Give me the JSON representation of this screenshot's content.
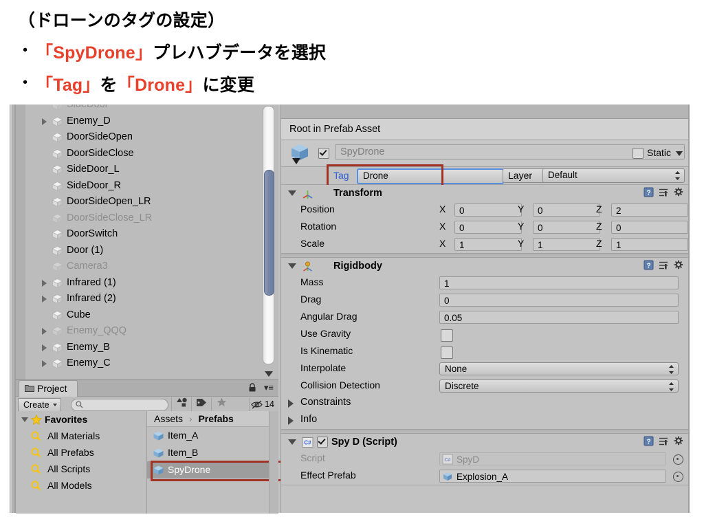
{
  "slide": {
    "line1": "（ドローンのタグの設定）",
    "bullet": "・",
    "line2_a": "「SpyDrone」",
    "line2_b": "プレハブデータを選択",
    "line3_a": "「Tag」",
    "line3_b": "を",
    "line3_c": "「Drone」",
    "line3_d": "に変更",
    "accent_color": "#e8402a"
  },
  "hierarchy": {
    "rows": [
      {
        "label": "SideDoor",
        "expandable": false,
        "dim": true,
        "clipped": true
      },
      {
        "label": "Enemy_D",
        "expandable": true,
        "dim": false
      },
      {
        "label": "DoorSideOpen",
        "expandable": false,
        "dim": false
      },
      {
        "label": "DoorSideClose",
        "expandable": false,
        "dim": false
      },
      {
        "label": "SideDoor_L",
        "expandable": false,
        "dim": false
      },
      {
        "label": "SideDoor_R",
        "expandable": false,
        "dim": false
      },
      {
        "label": "DoorSideOpen_LR",
        "expandable": false,
        "dim": false
      },
      {
        "label": "DoorSideClose_LR",
        "expandable": false,
        "dim": true
      },
      {
        "label": "DoorSwitch",
        "expandable": false,
        "dim": false
      },
      {
        "label": "Door (1)",
        "expandable": false,
        "dim": false
      },
      {
        "label": "Camera3",
        "expandable": false,
        "dim": true
      },
      {
        "label": "Infrared (1)",
        "expandable": true,
        "dim": false
      },
      {
        "label": "Infrared (2)",
        "expandable": true,
        "dim": false
      },
      {
        "label": "Cube",
        "expandable": false,
        "dim": false
      },
      {
        "label": "Enemy_QQQ",
        "expandable": true,
        "dim": true
      },
      {
        "label": "Enemy_B",
        "expandable": true,
        "dim": false
      },
      {
        "label": "Enemy_C",
        "expandable": true,
        "dim": false
      }
    ]
  },
  "project": {
    "tab_label": "Project",
    "toolbar": {
      "create_label": "Create",
      "search_placeholder": "",
      "hidden_count": "14"
    },
    "favorites": {
      "header": "Favorites",
      "items": [
        "All Materials",
        "All Prefabs",
        "All Scripts",
        "All Models"
      ]
    },
    "breadcrumb": {
      "root": "Assets",
      "separator": "›",
      "current": "Prefabs"
    },
    "assets": [
      {
        "name": "Item_A",
        "selected": false
      },
      {
        "name": "Item_B",
        "selected": false
      },
      {
        "name": "SpyDrone",
        "selected": true
      }
    ]
  },
  "inspector": {
    "prefab_bar": "Root in Prefab Asset",
    "object": {
      "enabled": true,
      "name": "SpyDrone",
      "static_label": "Static",
      "static_checked": false
    },
    "tag_row": {
      "tag_label": "Tag",
      "tag_value": "Drone",
      "layer_label": "Layer",
      "layer_value": "Default"
    },
    "transform": {
      "title": "Transform",
      "rows": [
        {
          "label": "Position",
          "x": "0",
          "y": "0",
          "z": "2"
        },
        {
          "label": "Rotation",
          "x": "0",
          "y": "0",
          "z": "0"
        },
        {
          "label": "Scale",
          "x": "1",
          "y": "1",
          "z": "1"
        }
      ],
      "axis_labels": [
        "X",
        "Y",
        "Z"
      ]
    },
    "rigidbody": {
      "title": "Rigidbody",
      "mass_label": "Mass",
      "mass_value": "1",
      "drag_label": "Drag",
      "drag_value": "0",
      "angular_drag_label": "Angular Drag",
      "angular_drag_value": "0.05",
      "use_gravity_label": "Use Gravity",
      "use_gravity_checked": false,
      "is_kinematic_label": "Is Kinematic",
      "is_kinematic_checked": false,
      "interpolate_label": "Interpolate",
      "interpolate_value": "None",
      "collision_label": "Collision Detection",
      "collision_value": "Discrete",
      "constraints_label": "Constraints",
      "info_label": "Info"
    },
    "script": {
      "title": "Spy D (Script)",
      "enabled": true,
      "script_label": "Script",
      "script_value": "SpyD",
      "effect_label": "Effect Prefab",
      "effect_value": "Explosion_A"
    }
  },
  "annotation": {
    "color": "#a03323"
  }
}
